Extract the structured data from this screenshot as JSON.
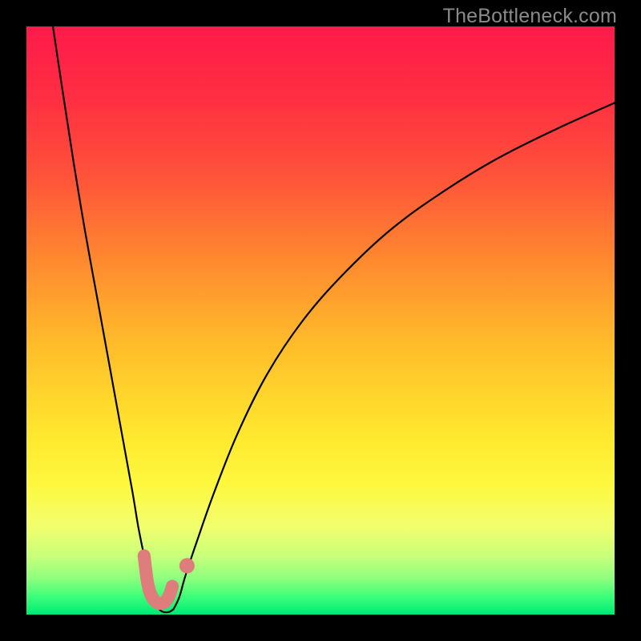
{
  "watermark": "TheBottleneck.com",
  "colors": {
    "frame": "#000000",
    "curve": "#000000",
    "marker": "#de7d7c",
    "gradient_stops": [
      {
        "offset": 0.0,
        "color": "#ff1a4b"
      },
      {
        "offset": 0.12,
        "color": "#ff2e42"
      },
      {
        "offset": 0.25,
        "color": "#ff513a"
      },
      {
        "offset": 0.4,
        "color": "#ff8a2f"
      },
      {
        "offset": 0.55,
        "color": "#ffbf2a"
      },
      {
        "offset": 0.7,
        "color": "#ffe92e"
      },
      {
        "offset": 0.78,
        "color": "#fdf83f"
      },
      {
        "offset": 0.85,
        "color": "#f2ff6d"
      },
      {
        "offset": 0.9,
        "color": "#c9ff7a"
      },
      {
        "offset": 0.94,
        "color": "#8bff7e"
      },
      {
        "offset": 0.97,
        "color": "#3bff79"
      },
      {
        "offset": 1.0,
        "color": "#00e874"
      }
    ]
  },
  "chart_data": {
    "type": "line",
    "title": "",
    "xlabel": "",
    "ylabel": "",
    "xlim": [
      0,
      100
    ],
    "ylim": [
      0,
      100
    ],
    "series": [
      {
        "name": "left-curve",
        "x": [
          4.5,
          6,
          8,
          10,
          12,
          14,
          16,
          18,
          19,
          20,
          20.5,
          21,
          21.5,
          22,
          22.6
        ],
        "values": [
          100,
          90,
          77,
          65,
          54,
          43,
          32,
          21,
          15,
          10,
          7.5,
          5.2,
          3.4,
          2.0,
          0.9
        ]
      },
      {
        "name": "right-curve",
        "x": [
          25,
          26,
          27,
          29,
          32,
          36,
          41,
          47,
          54,
          62,
          71,
          80,
          90,
          100
        ],
        "values": [
          0.9,
          3.0,
          6.5,
          12.5,
          21,
          31,
          41,
          50,
          58,
          65.5,
          72,
          77.5,
          82.5,
          87
        ]
      },
      {
        "name": "floor",
        "x": [
          22.6,
          23.0,
          23.5,
          24.0,
          24.5,
          25.0
        ],
        "values": [
          0.9,
          0.55,
          0.4,
          0.4,
          0.55,
          0.9
        ]
      }
    ],
    "markers": [
      {
        "name": "u-marker",
        "type": "path",
        "stroke_width_pct": 2.2,
        "points": [
          {
            "x": 20.0,
            "y": 10.0
          },
          {
            "x": 20.3,
            "y": 7.5
          },
          {
            "x": 20.6,
            "y": 5.4
          },
          {
            "x": 21.0,
            "y": 3.8
          },
          {
            "x": 21.6,
            "y": 2.6
          },
          {
            "x": 22.3,
            "y": 2.0
          },
          {
            "x": 23.0,
            "y": 1.9
          },
          {
            "x": 23.7,
            "y": 2.3
          },
          {
            "x": 24.3,
            "y": 3.3
          },
          {
            "x": 24.8,
            "y": 4.8
          }
        ]
      },
      {
        "name": "dot-marker",
        "type": "dot",
        "x": 27.3,
        "y": 8.3,
        "r_pct": 1.3
      }
    ]
  }
}
